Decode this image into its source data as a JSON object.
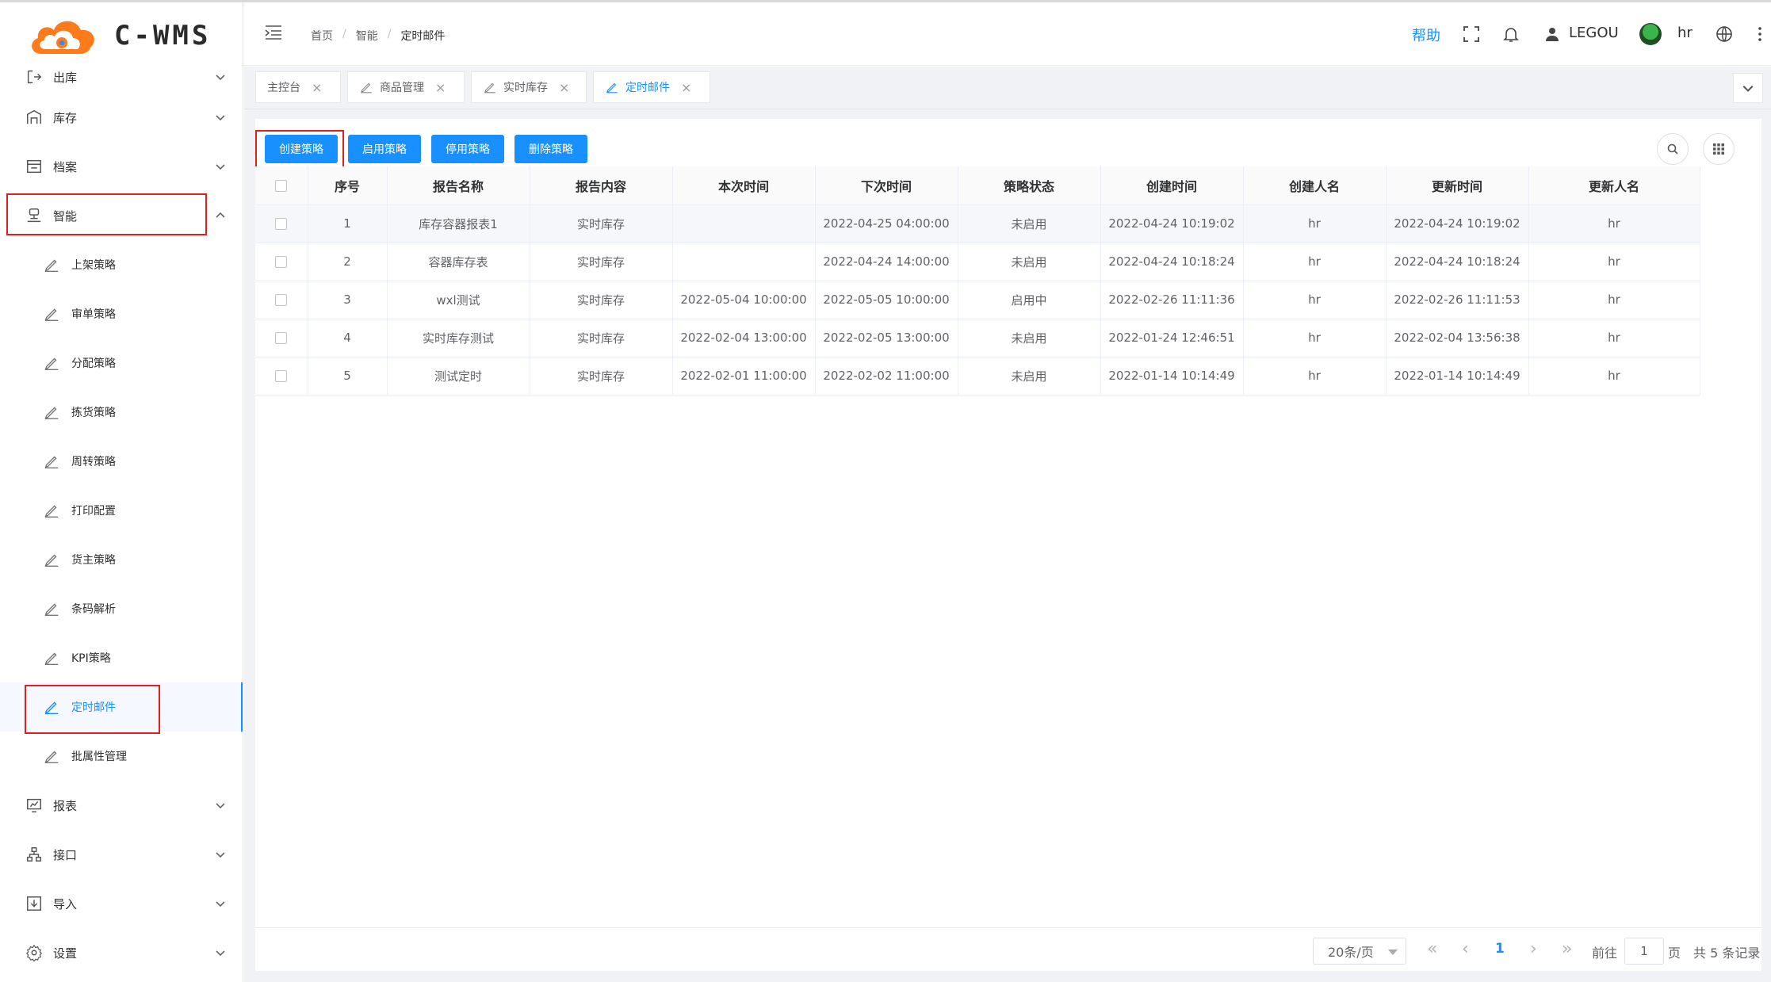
{
  "app": {
    "logo_text": "C-WMS"
  },
  "sidebar": {
    "top_partial": "出库",
    "groups": [
      {
        "label": "库存"
      },
      {
        "label": "档案"
      },
      {
        "label": "智能"
      }
    ],
    "sub_items": [
      {
        "label": "上架策略"
      },
      {
        "label": "审单策略"
      },
      {
        "label": "分配策略"
      },
      {
        "label": "拣货策略"
      },
      {
        "label": "周转策略"
      },
      {
        "label": "打印配置"
      },
      {
        "label": "货主策略"
      },
      {
        "label": "条码解析"
      },
      {
        "label": "KPI策略"
      },
      {
        "label": "定时邮件"
      },
      {
        "label": "批属性管理"
      }
    ],
    "bottom_groups": [
      {
        "label": "报表"
      },
      {
        "label": "接口"
      },
      {
        "label": "导入"
      },
      {
        "label": "设置"
      }
    ]
  },
  "header": {
    "breadcrumb": [
      "首页",
      "智能",
      "定时邮件"
    ],
    "help": "帮助",
    "company": "LEGOU",
    "user": "hr"
  },
  "tabs": [
    {
      "label": "主控台"
    },
    {
      "label": "商品管理"
    },
    {
      "label": "实时库存"
    },
    {
      "label": "定时邮件"
    }
  ],
  "toolbar": {
    "create": "创建策略",
    "enable": "启用策略",
    "disable": "停用策略",
    "delete": "删除策略"
  },
  "table": {
    "columns": [
      "序号",
      "报告名称",
      "报告内容",
      "本次时间",
      "下次时间",
      "策略状态",
      "创建时间",
      "创建人名",
      "更新时间",
      "更新人名"
    ],
    "rows": [
      [
        "1",
        "库存容器报表1",
        "实时库存",
        "",
        "2022-04-25 04:00:00",
        "未启用",
        "2022-04-24 10:19:02",
        "hr",
        "2022-04-24 10:19:02",
        "hr"
      ],
      [
        "2",
        "容器库存表",
        "实时库存",
        "",
        "2022-04-24 14:00:00",
        "未启用",
        "2022-04-24 10:18:24",
        "hr",
        "2022-04-24 10:18:24",
        "hr"
      ],
      [
        "3",
        "wxl测试",
        "实时库存",
        "2022-05-04 10:00:00",
        "2022-05-05 10:00:00",
        "启用中",
        "2022-02-26 11:11:36",
        "hr",
        "2022-02-26 11:11:53",
        "hr"
      ],
      [
        "4",
        "实时库存测试",
        "实时库存",
        "2022-02-04 13:00:00",
        "2022-02-05 13:00:00",
        "未启用",
        "2022-01-24 12:46:51",
        "hr",
        "2022-02-04 13:56:38",
        "hr"
      ],
      [
        "5",
        "测试定时",
        "实时库存",
        "2022-02-01 11:00:00",
        "2022-02-02 11:00:00",
        "未启用",
        "2022-01-14 10:14:49",
        "hr",
        "2022-01-14 10:14:49",
        "hr"
      ]
    ]
  },
  "pagination": {
    "page_size": "20条/页",
    "current_page": "1",
    "goto_prefix": "前往",
    "goto_value": "1",
    "goto_suffix": "页",
    "total": "共 5 条记录"
  },
  "colors": {
    "primary": "#1890ff",
    "highlight": "#e02020"
  }
}
